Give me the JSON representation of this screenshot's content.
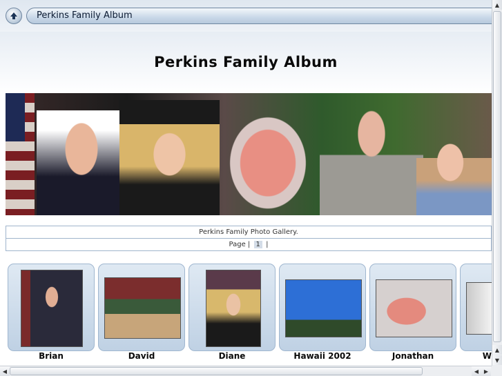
{
  "location_bar": {
    "title": "Perkins Family Album"
  },
  "page": {
    "heading": "Perkins Family Album",
    "banner_alt": "Perkins family banner photo"
  },
  "gallery": {
    "caption": "Perkins Family Photo Gallery.",
    "pager_prefix": "Page |",
    "current_page": "1",
    "pager_suffix": "|"
  },
  "albums": [
    {
      "label": "Brian"
    },
    {
      "label": "David"
    },
    {
      "label": "Diane"
    },
    {
      "label": "Hawaii 2002"
    },
    {
      "label": "Jonathan"
    },
    {
      "label": "W"
    }
  ]
}
